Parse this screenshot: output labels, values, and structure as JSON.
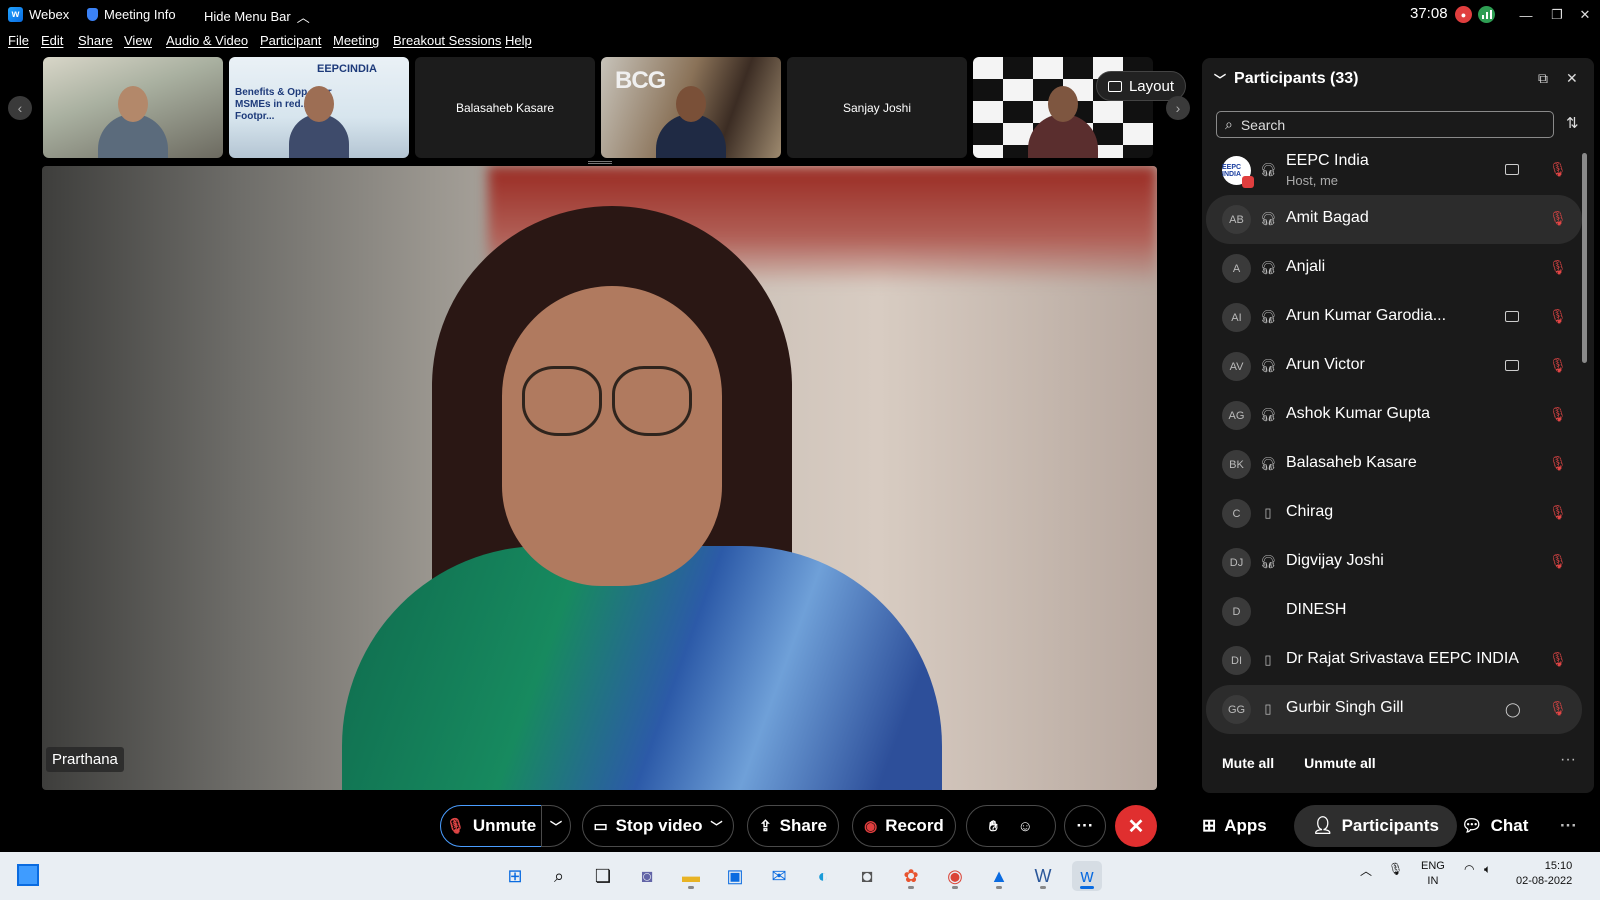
{
  "titlebar": {
    "app_name": "Webex",
    "meeting_info": "Meeting Info",
    "hide_menu_bar": "Hide Menu Bar",
    "timer": "37:08"
  },
  "menu": [
    "File",
    "Edit",
    "Share",
    "View",
    "Audio & Video",
    "Participant",
    "Meeting",
    "Breakout Sessions",
    "Help"
  ],
  "filmstrip": {
    "tiles": [
      {
        "label": ""
      },
      {
        "label": "",
        "slide_brand": "EEPCINDIA",
        "slide_text": "Benefits & Opp... for MSMEs in red... bon Footpr..."
      },
      {
        "label": "Balasaheb Kasare"
      },
      {
        "label": "",
        "brand": "BCG"
      },
      {
        "label": "Sanjay Joshi"
      },
      {
        "label": ""
      }
    ],
    "layout_label": "Layout"
  },
  "main_video": {
    "speaker_name": "Prarthana"
  },
  "participants_panel": {
    "title": "Participants (33)",
    "search_placeholder": "Search",
    "participants": [
      {
        "initials": "EEPC INDIA",
        "name": "EEPC India",
        "subtitle": "Host, me",
        "device": "headset",
        "video": true,
        "chat": false,
        "muted": true
      },
      {
        "initials": "AB",
        "name": "Amit Bagad",
        "device": "headset",
        "video": false,
        "chat": false,
        "muted": true
      },
      {
        "initials": "A",
        "name": "Anjali",
        "device": "headset",
        "video": false,
        "chat": false,
        "muted": true
      },
      {
        "initials": "AI",
        "name": "Arun Kumar Garodia...",
        "device": "headset",
        "video": true,
        "chat": false,
        "muted": true
      },
      {
        "initials": "AV",
        "name": "Arun Victor",
        "device": "headset",
        "video": true,
        "chat": false,
        "muted": true
      },
      {
        "initials": "AG",
        "name": "Ashok Kumar Gupta",
        "device": "headset",
        "video": false,
        "chat": false,
        "muted": true
      },
      {
        "initials": "BK",
        "name": "Balasaheb Kasare",
        "device": "headset",
        "video": false,
        "chat": false,
        "muted": true
      },
      {
        "initials": "C",
        "name": "Chirag",
        "device": "phone",
        "video": false,
        "chat": false,
        "muted": true
      },
      {
        "initials": "DJ",
        "name": "Digvijay Joshi",
        "device": "headset",
        "video": false,
        "chat": false,
        "muted": true
      },
      {
        "initials": "D",
        "name": "DINESH",
        "device": "none",
        "video": false,
        "chat": false,
        "muted": false
      },
      {
        "initials": "DI",
        "name": "Dr Rajat Srivastava EEPC INDIA",
        "device": "phone",
        "video": false,
        "chat": false,
        "muted": true
      },
      {
        "initials": "GG",
        "name": "Gurbir Singh Gill",
        "device": "phone",
        "video": false,
        "chat": true,
        "muted": true
      }
    ],
    "mute_all": "Mute all",
    "unmute_all": "Unmute all"
  },
  "controls": {
    "unmute": "Unmute",
    "stop_video": "Stop video",
    "share": "Share",
    "record": "Record",
    "apps": "Apps",
    "participants": "Participants",
    "chat": "Chat"
  },
  "taskbar": {
    "lang_top": "ENG",
    "lang_bottom": "IN",
    "time": "15:10",
    "date": "02-08-2022"
  },
  "colors": {
    "accent_blue": "#4a9dff",
    "end_call_red": "#e02f2f",
    "mute_red": "#e04545",
    "panel_bg": "#1a1a1a"
  }
}
